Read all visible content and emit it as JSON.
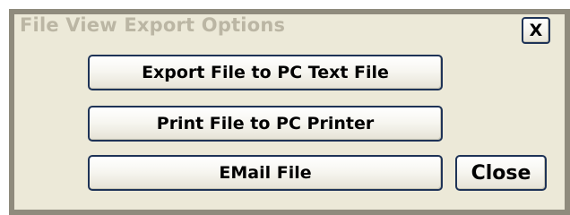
{
  "dialog": {
    "title": "File View Export Options",
    "close_x_label": "X"
  },
  "buttons": {
    "export_label": "Export File to PC Text File",
    "print_label": "Print File to PC Printer",
    "email_label": "EMail File",
    "close_label": "Close"
  },
  "colors": {
    "dialog_background": "#ece9d8",
    "dialog_border": "#8f8b7d",
    "title_text": "#bbb6a4",
    "button_border": "#1e3357"
  }
}
